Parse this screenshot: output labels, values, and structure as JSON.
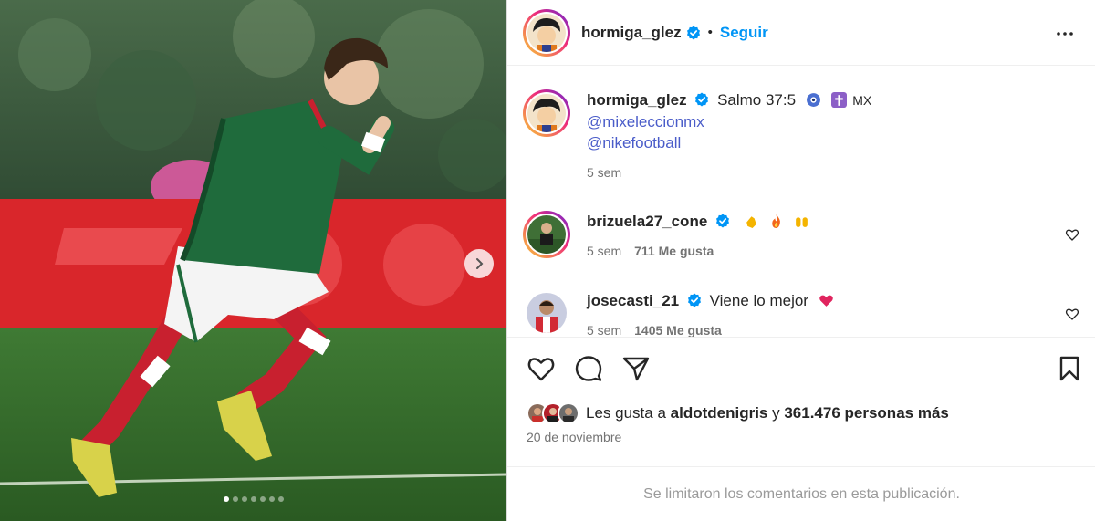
{
  "post": {
    "author": "hormiga_glez",
    "follow_label": "Seguir",
    "separator": "•",
    "carousel": {
      "slide_count": 7,
      "active_index": 0
    }
  },
  "caption": {
    "username": "hormiga_glez",
    "text": "Salmo 37:5",
    "suffix": "MX",
    "mentions": [
      "@mixeleccionmx",
      "@nikefootball"
    ],
    "time": "5 sem"
  },
  "comments": [
    {
      "username": "brizuela27_cone",
      "text": "",
      "emojis": [
        "clap-emoji",
        "fire-emoji",
        "raised-hands-emoji"
      ],
      "time": "5 sem",
      "likes": "711 Me gusta"
    },
    {
      "username": "josecasti_21",
      "text": "Viene lo mejor",
      "emojis": [
        "heart-emoji"
      ],
      "time": "5 sem",
      "likes": "1405 Me gusta"
    }
  ],
  "likes": {
    "prefix": "Les gusta a",
    "user": "aldotdenigris",
    "connector": "y",
    "count": "361.476 personas más"
  },
  "date": "20 de noviembre",
  "comments_limited": "Se limitaron los comentarios en esta publicación.",
  "colors": {
    "accent": "#0095f6",
    "mention": "#4a5cc9",
    "muted": "#737373",
    "jersey_green": "#1f6b3c",
    "sock_red": "#c8202f"
  }
}
